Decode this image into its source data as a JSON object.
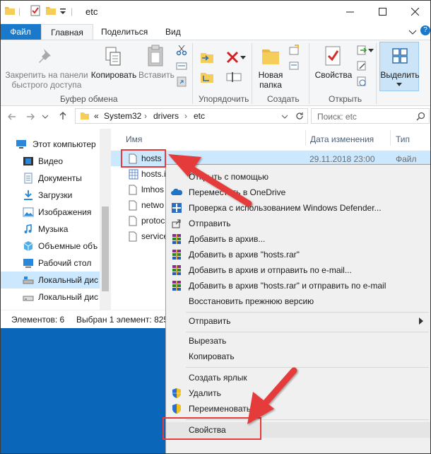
{
  "window": {
    "title": "etc",
    "tabs": {
      "file": "Файл",
      "home": "Главная",
      "share": "Поделиться",
      "view": "Вид"
    },
    "help_glyph": "?"
  },
  "ribbon": {
    "pin_label_1": "Закрепить на панели",
    "pin_label_2": "быстрого доступа",
    "copy_label": "Копировать",
    "paste_label": "Вставить",
    "clipboard_group": "Буфер обмена",
    "organize_group": "Упорядочить",
    "new_folder_label_1": "Новая",
    "new_folder_label_2": "папка",
    "create_group": "Создать",
    "properties_label": "Свойства",
    "open_group": "Открыть",
    "select_label": "Выделить"
  },
  "address": {
    "breadcrumb": [
      "System32",
      "drivers",
      "etc"
    ],
    "overflow": "«",
    "search_placeholder": "Поиск: etc"
  },
  "nav": {
    "items": [
      {
        "label": "Этот компьютер"
      },
      {
        "label": "Видео"
      },
      {
        "label": "Документы"
      },
      {
        "label": "Загрузки"
      },
      {
        "label": "Изображения"
      },
      {
        "label": "Музыка"
      },
      {
        "label": "Объемные объ"
      },
      {
        "label": "Рабочий стол"
      },
      {
        "label": "Локальный дис"
      },
      {
        "label": "Локальный дис"
      }
    ]
  },
  "list": {
    "columns": {
      "name": "Имя",
      "date": "Дата изменения",
      "type": "Тип"
    },
    "files": [
      {
        "name": "hosts",
        "date": "29.11.2018 23:00",
        "type": "Файл"
      },
      {
        "name": "hosts.i"
      },
      {
        "name": "lmhos"
      },
      {
        "name": "netwo"
      },
      {
        "name": "protoc"
      },
      {
        "name": "service"
      }
    ]
  },
  "status": {
    "count": "Элементов: 6",
    "selected": "Выбран 1 элемент: 825"
  },
  "context_menu": {
    "open_with": "Открыть с помощью",
    "onedrive": "Переместить в OneDrive",
    "defender": "Проверка с использованием Windows Defender...",
    "send_to_1": "Отправить",
    "add_archive": "Добавить в архив...",
    "add_hosts_rar": "Добавить в архив \"hosts.rar\"",
    "add_email": "Добавить в архив и отправить по e-mail...",
    "add_hosts_email": "Добавить в архив \"hosts.rar\" и отправить по e-mail",
    "restore": "Восстановить прежнюю версию",
    "send_to_2": "Отправить",
    "cut": "Вырезать",
    "copy": "Копировать",
    "shortcut": "Создать ярлык",
    "delete": "Удалить",
    "rename": "Переименовать",
    "properties": "Свойства"
  }
}
